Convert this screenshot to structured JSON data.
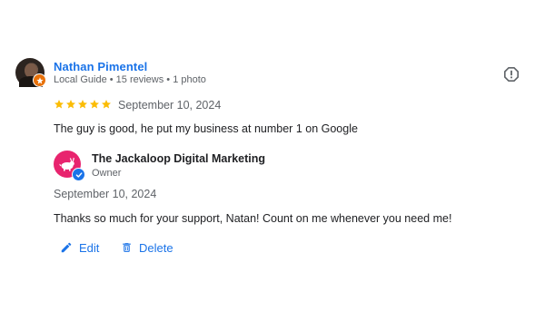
{
  "reviewer": {
    "name": "Nathan Pimentel",
    "meta": "Local Guide • 15 reviews • 1 photo"
  },
  "review": {
    "rating": 5,
    "rating_max": 5,
    "date": "September 10, 2024",
    "text": "The guy is good, he put my business at number 1 on Google"
  },
  "owner_reply": {
    "business_name": "The Jackaloop Digital Marketing",
    "role": "Owner",
    "date": "September 10, 2024",
    "text": "Thanks so much for your support, Natan! Count on me whenever you need me!"
  },
  "actions": {
    "edit_label": "Edit",
    "delete_label": "Delete"
  },
  "colors": {
    "link_blue": "#1a73e8",
    "star_gold": "#fbbc04",
    "owner_avatar": "#e8246e",
    "local_guide_orange": "#e8710a",
    "meta_gray": "#5f6368"
  },
  "icons": {
    "report": "report-icon",
    "edit": "pencil-icon",
    "delete": "trash-icon",
    "verified": "verified-check-icon",
    "local_guide": "local-guide-badge-icon"
  }
}
